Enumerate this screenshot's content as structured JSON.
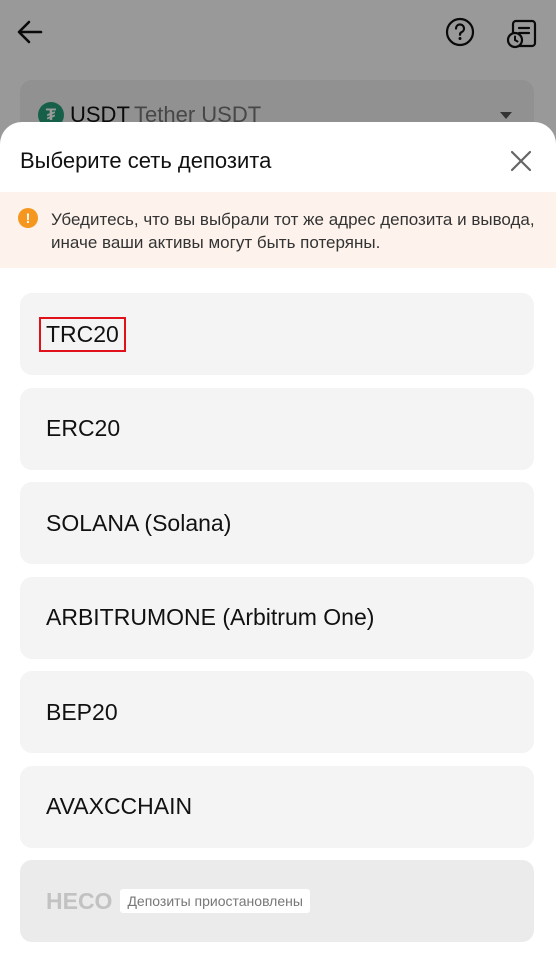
{
  "header": {
    "back_icon": "arrow-left-icon",
    "help_icon": "question-circle-icon",
    "history_icon": "history-record-icon"
  },
  "coin": {
    "symbol": "USDT",
    "name": "Tether USDT",
    "logo_glyph": "₮",
    "logo_color": "#26a17b"
  },
  "sheet": {
    "title": "Выберите сеть депозита",
    "warning": "Убедитесь, что вы выбрали тот же адрес депозита и вывода, иначе ваши активы могут быть потеряны.",
    "warning_color": "#f5961e"
  },
  "networks": [
    {
      "label": "TRC20",
      "state": "selected"
    },
    {
      "label": "ERC20",
      "state": "normal"
    },
    {
      "label": "SOLANA (Solana)",
      "state": "normal"
    },
    {
      "label": "ARBITRUMONE (Arbitrum One)",
      "state": "normal"
    },
    {
      "label": "BEP20",
      "state": "normal"
    },
    {
      "label": "AVAXCCHAIN",
      "state": "normal"
    },
    {
      "label": "HECO",
      "state": "disabled",
      "badge": "Депозиты приостановлены"
    }
  ]
}
